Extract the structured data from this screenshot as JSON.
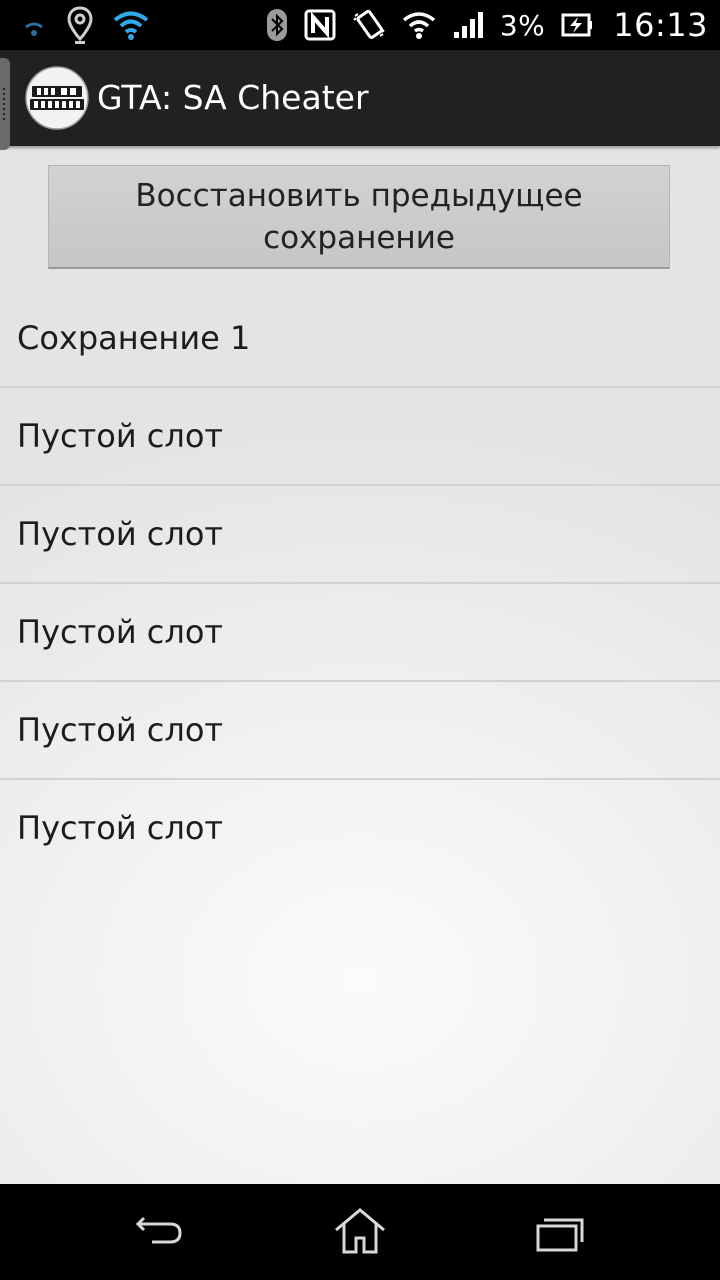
{
  "status_bar": {
    "battery_percent": "3%",
    "time": "16:13",
    "left_icons": [
      "wifi-small-icon",
      "location-pin-icon",
      "wifi-icon"
    ],
    "right_icons": [
      "bluetooth-icon",
      "nfc-icon",
      "vibrate-icon",
      "wifi-icon",
      "signal-icon",
      "battery-charging-icon"
    ]
  },
  "action_bar": {
    "title": "GTA: SA Cheater",
    "logo_icon": "gta-sa-logo-icon"
  },
  "restore_button": {
    "label": "Восстановить предыдущее сохранение"
  },
  "save_slots": [
    {
      "label": "Сохранение 1"
    },
    {
      "label": "Пустой слот"
    },
    {
      "label": "Пустой слот"
    },
    {
      "label": "Пустой слот"
    },
    {
      "label": "Пустой слот"
    },
    {
      "label": "Пустой слот"
    }
  ],
  "nav_bar": {
    "icons": [
      "back-icon",
      "home-icon",
      "recent-apps-icon"
    ]
  },
  "colors": {
    "status_bar_bg": "#000000",
    "action_bar_bg": "#212121",
    "content_bg": "#ececec",
    "button_bg": "#cccccc",
    "text": "#1c1c1c",
    "divider": "#d2d2d2"
  }
}
